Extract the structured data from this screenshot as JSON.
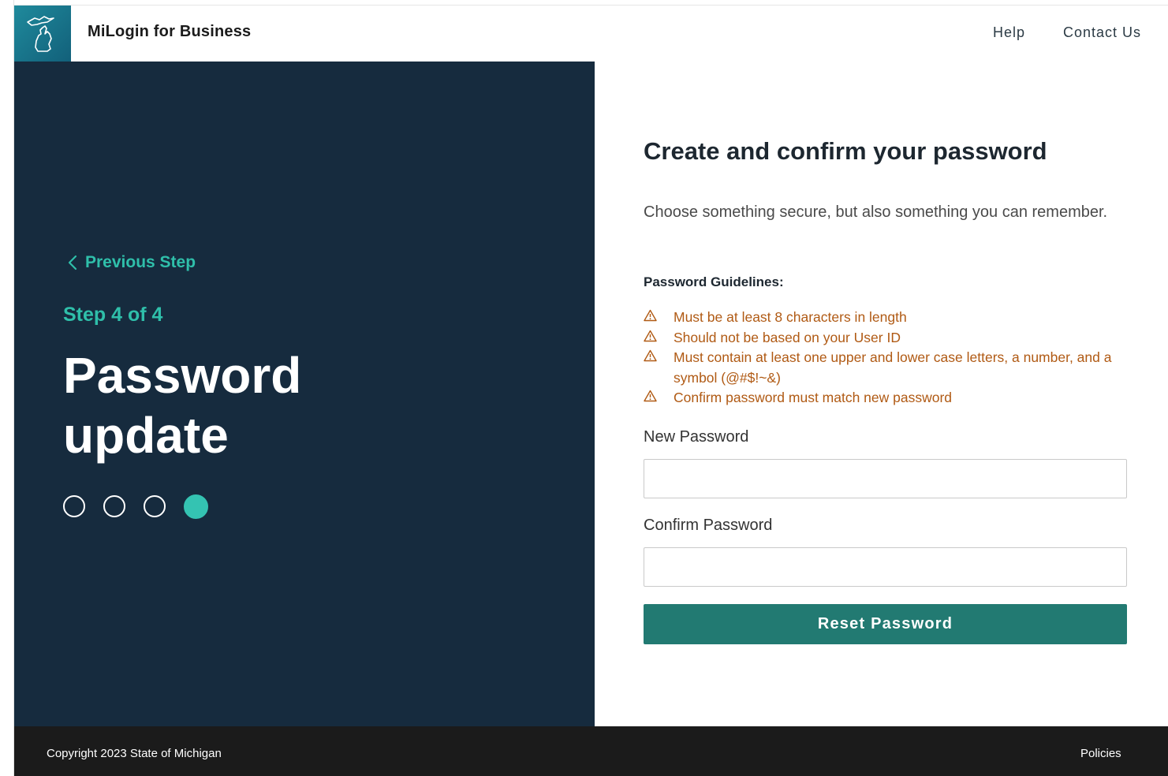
{
  "header": {
    "app_title": "MiLogin for Business",
    "logo_icon": "michigan-state-outline-icon",
    "nav": {
      "help": "Help",
      "contact": "Contact Us"
    }
  },
  "left_panel": {
    "previous_step": "Previous Step",
    "step_count": "Step 4 of 4",
    "title": "Password update",
    "progress": {
      "total_steps": 4,
      "current_step": 4
    }
  },
  "form": {
    "title": "Create and confirm your password",
    "subtitle": "Choose something secure, but also something you can remember.",
    "guidelines_title": "Password Guidelines:",
    "guidelines": [
      "Must be at least 8 characters in length",
      "Should not be based on your User ID",
      "Must contain at least one upper and lower case letters, a number, and a symbol (@#$!~&)",
      "Confirm password must match new password"
    ],
    "new_password_label": "New Password",
    "new_password_value": "",
    "confirm_password_label": "Confirm Password",
    "confirm_password_value": "",
    "submit_label": "Reset Password"
  },
  "footer": {
    "copyright": "Copyright 2023 State of Michigan",
    "policies": "Policies"
  },
  "colors": {
    "panel_bg": "#162b3e",
    "accent_teal": "#2fbfaa",
    "button": "#227a72",
    "warning": "#b05a14",
    "footer_bg": "#1b1b1b"
  }
}
